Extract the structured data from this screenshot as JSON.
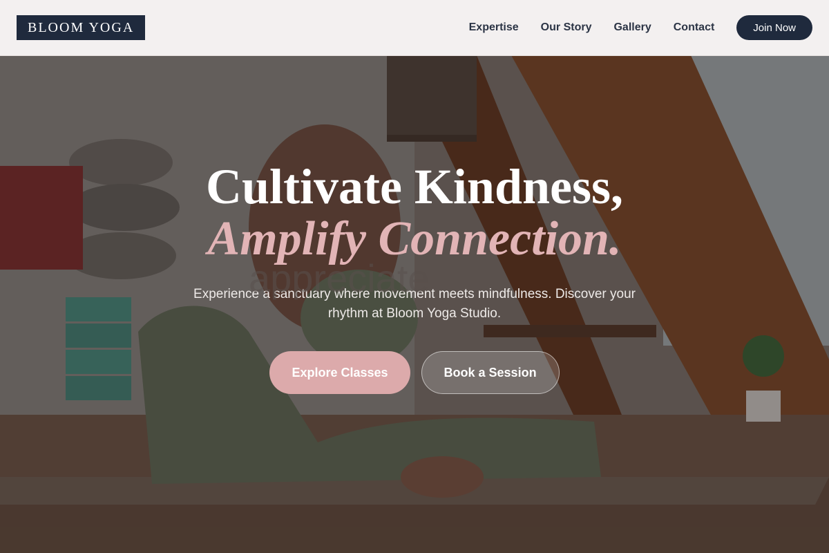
{
  "brand": {
    "logo_text": "BLOOM YOGA"
  },
  "nav": {
    "items": [
      {
        "label": "Expertise"
      },
      {
        "label": "Our Story"
      },
      {
        "label": "Gallery"
      },
      {
        "label": "Contact"
      }
    ],
    "cta_label": "Join Now"
  },
  "hero": {
    "headline_line1": "Cultivate Kindness,",
    "headline_line2": "Amplify Connection.",
    "background_text": "appreciate",
    "subtitle": "Experience a sanctuary where movement meets mindfulness. Discover your rhythm at Bloom Yoga Studio.",
    "primary_cta": "Explore Classes",
    "secondary_cta": "Book a Session"
  },
  "colors": {
    "navy": "#1f2a3d",
    "blush": "#dcaaab",
    "headline_accent": "#e2b4b6",
    "header_bg": "#faf7f7"
  }
}
